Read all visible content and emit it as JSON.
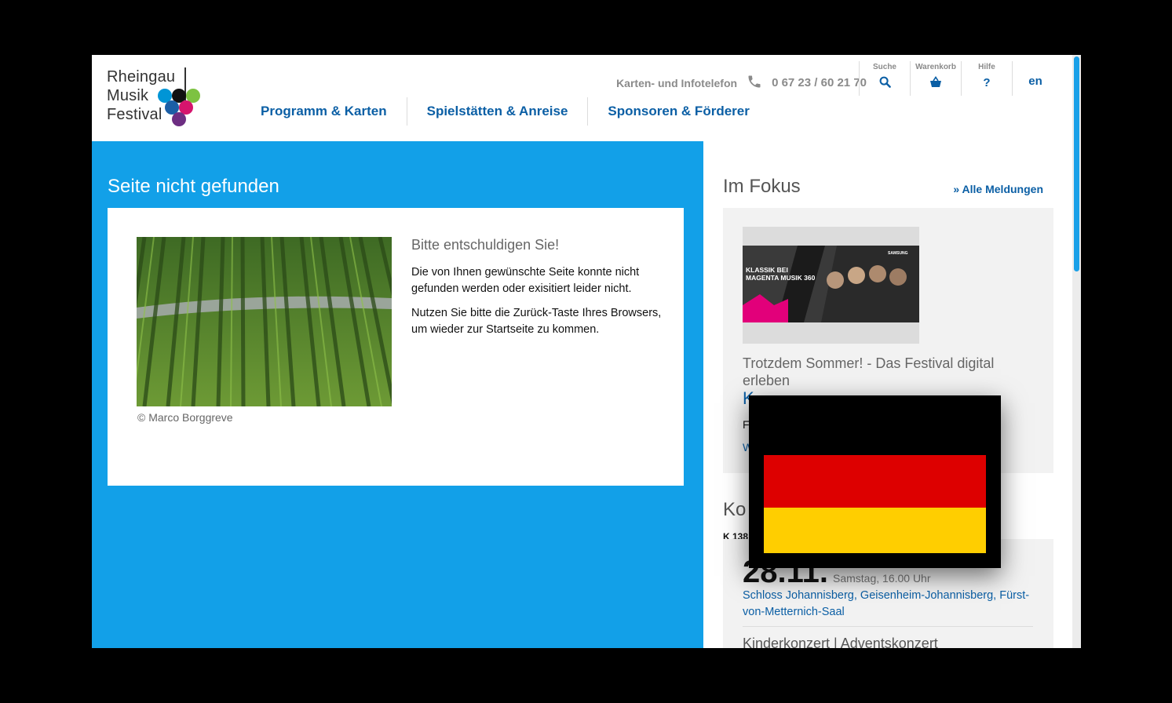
{
  "logo": {
    "line1": "Rheingau",
    "line2": "Musik",
    "line3": "Festival"
  },
  "nav": [
    {
      "label": "Programm & Karten"
    },
    {
      "label": "Spielstätten & Anreise"
    },
    {
      "label": "Sponsoren & Förderer"
    }
  ],
  "header": {
    "phone_label": "Karten- und Infotelefon",
    "phone_number": "0 67 23 / 60 21 70",
    "search_label": "Suche",
    "cart_label": "Warenkorb",
    "help_label": "Hilfe",
    "help_icon": "?",
    "lang": "en"
  },
  "main": {
    "title": "Seite nicht gefunden",
    "heading": "Bitte entschuldigen Sie!",
    "para1": "Die von Ihnen gewünschte Seite konnte nicht gefunden werden oder exisitiert leider nicht.",
    "para2": "Nutzen Sie bitte die Zurück-Taste Ihres Browsers, um wieder zur Startseite zu kommen.",
    "credit": "© Marco Borggreve"
  },
  "sidebar": {
    "title": "Im Fokus",
    "more": "» Alle Meldungen",
    "fokus_title": "Trotzdem Sommer! - Das Festival digital erleben",
    "fokus_link": "K",
    "fokus_text": "F",
    "fokus_more": "W",
    "konzerte_title": "Ko",
    "konzert_code": "K 138",
    "konzert_date": "28.11.",
    "konzert_when": "Samstag, 16.00 Uhr",
    "konzert_venue": "Schloss Johannisberg, Geisenheim-Johannisberg, Fürst-von-Metternich-Saal",
    "konzert_next": "Kinderkonzert | Adventskonzert"
  },
  "banner": {
    "line1": "KLASSIK BEI",
    "line2": "MAGENTA MUSIK 360",
    "brand": "SAMSUNG"
  },
  "colors": {
    "accent": "#12a0e8",
    "link": "#0b5fa5",
    "flag_red": "#dd0000",
    "flag_gold": "#ffce00"
  }
}
